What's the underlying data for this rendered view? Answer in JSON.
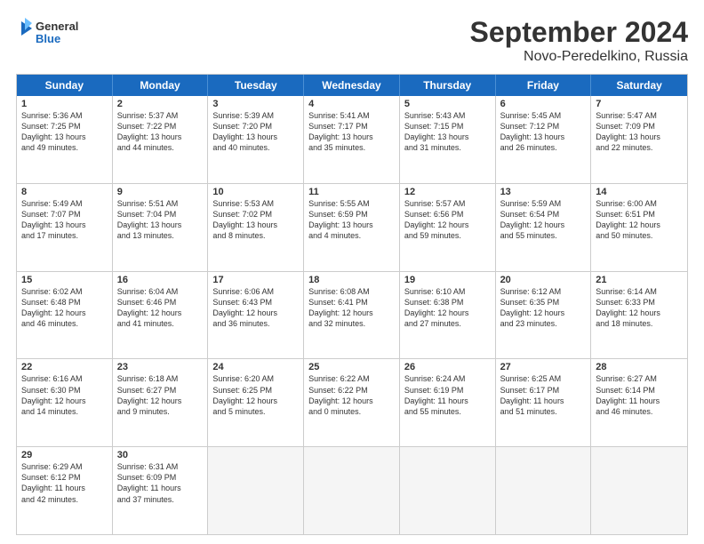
{
  "logo": {
    "text_general": "General",
    "text_blue": "Blue"
  },
  "header": {
    "month": "September 2024",
    "location": "Novo-Peredelkino, Russia"
  },
  "weekdays": [
    "Sunday",
    "Monday",
    "Tuesday",
    "Wednesday",
    "Thursday",
    "Friday",
    "Saturday"
  ],
  "rows": [
    [
      {
        "day": "1",
        "lines": [
          "Sunrise: 5:36 AM",
          "Sunset: 7:25 PM",
          "Daylight: 13 hours",
          "and 49 minutes."
        ]
      },
      {
        "day": "2",
        "lines": [
          "Sunrise: 5:37 AM",
          "Sunset: 7:22 PM",
          "Daylight: 13 hours",
          "and 44 minutes."
        ]
      },
      {
        "day": "3",
        "lines": [
          "Sunrise: 5:39 AM",
          "Sunset: 7:20 PM",
          "Daylight: 13 hours",
          "and 40 minutes."
        ]
      },
      {
        "day": "4",
        "lines": [
          "Sunrise: 5:41 AM",
          "Sunset: 7:17 PM",
          "Daylight: 13 hours",
          "and 35 minutes."
        ]
      },
      {
        "day": "5",
        "lines": [
          "Sunrise: 5:43 AM",
          "Sunset: 7:15 PM",
          "Daylight: 13 hours",
          "and 31 minutes."
        ]
      },
      {
        "day": "6",
        "lines": [
          "Sunrise: 5:45 AM",
          "Sunset: 7:12 PM",
          "Daylight: 13 hours",
          "and 26 minutes."
        ]
      },
      {
        "day": "7",
        "lines": [
          "Sunrise: 5:47 AM",
          "Sunset: 7:09 PM",
          "Daylight: 13 hours",
          "and 22 minutes."
        ]
      }
    ],
    [
      {
        "day": "8",
        "lines": [
          "Sunrise: 5:49 AM",
          "Sunset: 7:07 PM",
          "Daylight: 13 hours",
          "and 17 minutes."
        ]
      },
      {
        "day": "9",
        "lines": [
          "Sunrise: 5:51 AM",
          "Sunset: 7:04 PM",
          "Daylight: 13 hours",
          "and 13 minutes."
        ]
      },
      {
        "day": "10",
        "lines": [
          "Sunrise: 5:53 AM",
          "Sunset: 7:02 PM",
          "Daylight: 13 hours",
          "and 8 minutes."
        ]
      },
      {
        "day": "11",
        "lines": [
          "Sunrise: 5:55 AM",
          "Sunset: 6:59 PM",
          "Daylight: 13 hours",
          "and 4 minutes."
        ]
      },
      {
        "day": "12",
        "lines": [
          "Sunrise: 5:57 AM",
          "Sunset: 6:56 PM",
          "Daylight: 12 hours",
          "and 59 minutes."
        ]
      },
      {
        "day": "13",
        "lines": [
          "Sunrise: 5:59 AM",
          "Sunset: 6:54 PM",
          "Daylight: 12 hours",
          "and 55 minutes."
        ]
      },
      {
        "day": "14",
        "lines": [
          "Sunrise: 6:00 AM",
          "Sunset: 6:51 PM",
          "Daylight: 12 hours",
          "and 50 minutes."
        ]
      }
    ],
    [
      {
        "day": "15",
        "lines": [
          "Sunrise: 6:02 AM",
          "Sunset: 6:48 PM",
          "Daylight: 12 hours",
          "and 46 minutes."
        ]
      },
      {
        "day": "16",
        "lines": [
          "Sunrise: 6:04 AM",
          "Sunset: 6:46 PM",
          "Daylight: 12 hours",
          "and 41 minutes."
        ]
      },
      {
        "day": "17",
        "lines": [
          "Sunrise: 6:06 AM",
          "Sunset: 6:43 PM",
          "Daylight: 12 hours",
          "and 36 minutes."
        ]
      },
      {
        "day": "18",
        "lines": [
          "Sunrise: 6:08 AM",
          "Sunset: 6:41 PM",
          "Daylight: 12 hours",
          "and 32 minutes."
        ]
      },
      {
        "day": "19",
        "lines": [
          "Sunrise: 6:10 AM",
          "Sunset: 6:38 PM",
          "Daylight: 12 hours",
          "and 27 minutes."
        ]
      },
      {
        "day": "20",
        "lines": [
          "Sunrise: 6:12 AM",
          "Sunset: 6:35 PM",
          "Daylight: 12 hours",
          "and 23 minutes."
        ]
      },
      {
        "day": "21",
        "lines": [
          "Sunrise: 6:14 AM",
          "Sunset: 6:33 PM",
          "Daylight: 12 hours",
          "and 18 minutes."
        ]
      }
    ],
    [
      {
        "day": "22",
        "lines": [
          "Sunrise: 6:16 AM",
          "Sunset: 6:30 PM",
          "Daylight: 12 hours",
          "and 14 minutes."
        ]
      },
      {
        "day": "23",
        "lines": [
          "Sunrise: 6:18 AM",
          "Sunset: 6:27 PM",
          "Daylight: 12 hours",
          "and 9 minutes."
        ]
      },
      {
        "day": "24",
        "lines": [
          "Sunrise: 6:20 AM",
          "Sunset: 6:25 PM",
          "Daylight: 12 hours",
          "and 5 minutes."
        ]
      },
      {
        "day": "25",
        "lines": [
          "Sunrise: 6:22 AM",
          "Sunset: 6:22 PM",
          "Daylight: 12 hours",
          "and 0 minutes."
        ]
      },
      {
        "day": "26",
        "lines": [
          "Sunrise: 6:24 AM",
          "Sunset: 6:19 PM",
          "Daylight: 11 hours",
          "and 55 minutes."
        ]
      },
      {
        "day": "27",
        "lines": [
          "Sunrise: 6:25 AM",
          "Sunset: 6:17 PM",
          "Daylight: 11 hours",
          "and 51 minutes."
        ]
      },
      {
        "day": "28",
        "lines": [
          "Sunrise: 6:27 AM",
          "Sunset: 6:14 PM",
          "Daylight: 11 hours",
          "and 46 minutes."
        ]
      }
    ],
    [
      {
        "day": "29",
        "lines": [
          "Sunrise: 6:29 AM",
          "Sunset: 6:12 PM",
          "Daylight: 11 hours",
          "and 42 minutes."
        ]
      },
      {
        "day": "30",
        "lines": [
          "Sunrise: 6:31 AM",
          "Sunset: 6:09 PM",
          "Daylight: 11 hours",
          "and 37 minutes."
        ]
      },
      {
        "day": "",
        "lines": []
      },
      {
        "day": "",
        "lines": []
      },
      {
        "day": "",
        "lines": []
      },
      {
        "day": "",
        "lines": []
      },
      {
        "day": "",
        "lines": []
      }
    ]
  ]
}
